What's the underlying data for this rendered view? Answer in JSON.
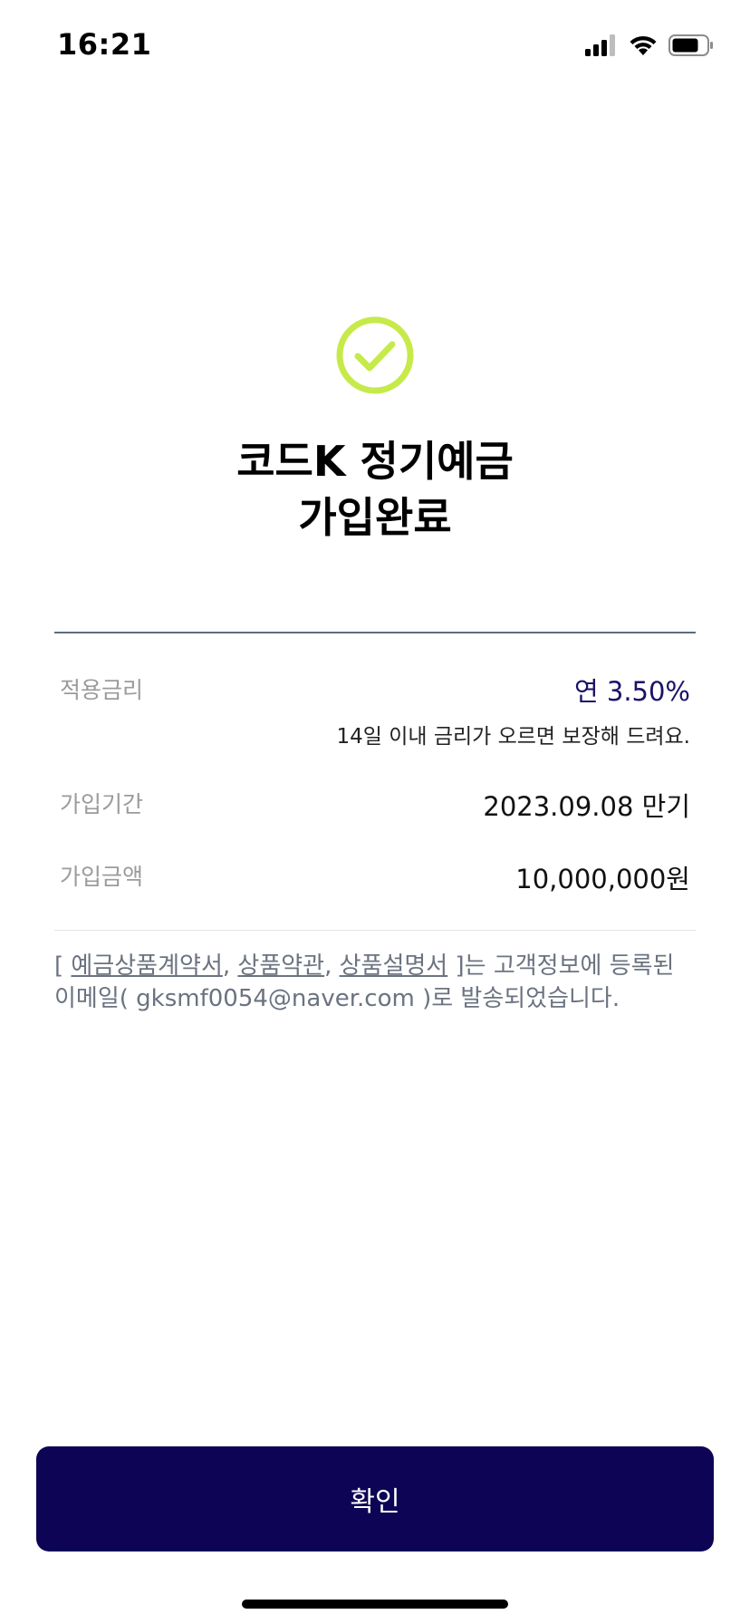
{
  "status_bar": {
    "time": "16:21",
    "icons": [
      "signal-icon",
      "wifi-icon",
      "battery-icon"
    ]
  },
  "result": {
    "icon": "check-circle-icon",
    "icon_color": "#c6ea4a",
    "title_line1": "코드K 정기예금",
    "title_line2": "가입완료"
  },
  "details": {
    "rate_label": "적용금리",
    "rate_value": "연 3.50%",
    "rate_note": "14일 이내 금리가 오르면 보장해 드려요.",
    "period_label": "가입기간",
    "period_value": "2023.09.08 만기",
    "amount_label": "가입금액",
    "amount_value": "10,000,000원"
  },
  "notice": {
    "open_bracket": "[ ",
    "doc1": "예금상품계약서",
    "sep1": ", ",
    "doc2": "상품약관",
    "sep2": ", ",
    "doc3": "상품설명서",
    "text": " ]는 고객정보에 등록된 이메일( gksmf0054@naver.com )로 발송되었습니다."
  },
  "confirm_button": {
    "label": "확인",
    "color": "#0e0455"
  }
}
